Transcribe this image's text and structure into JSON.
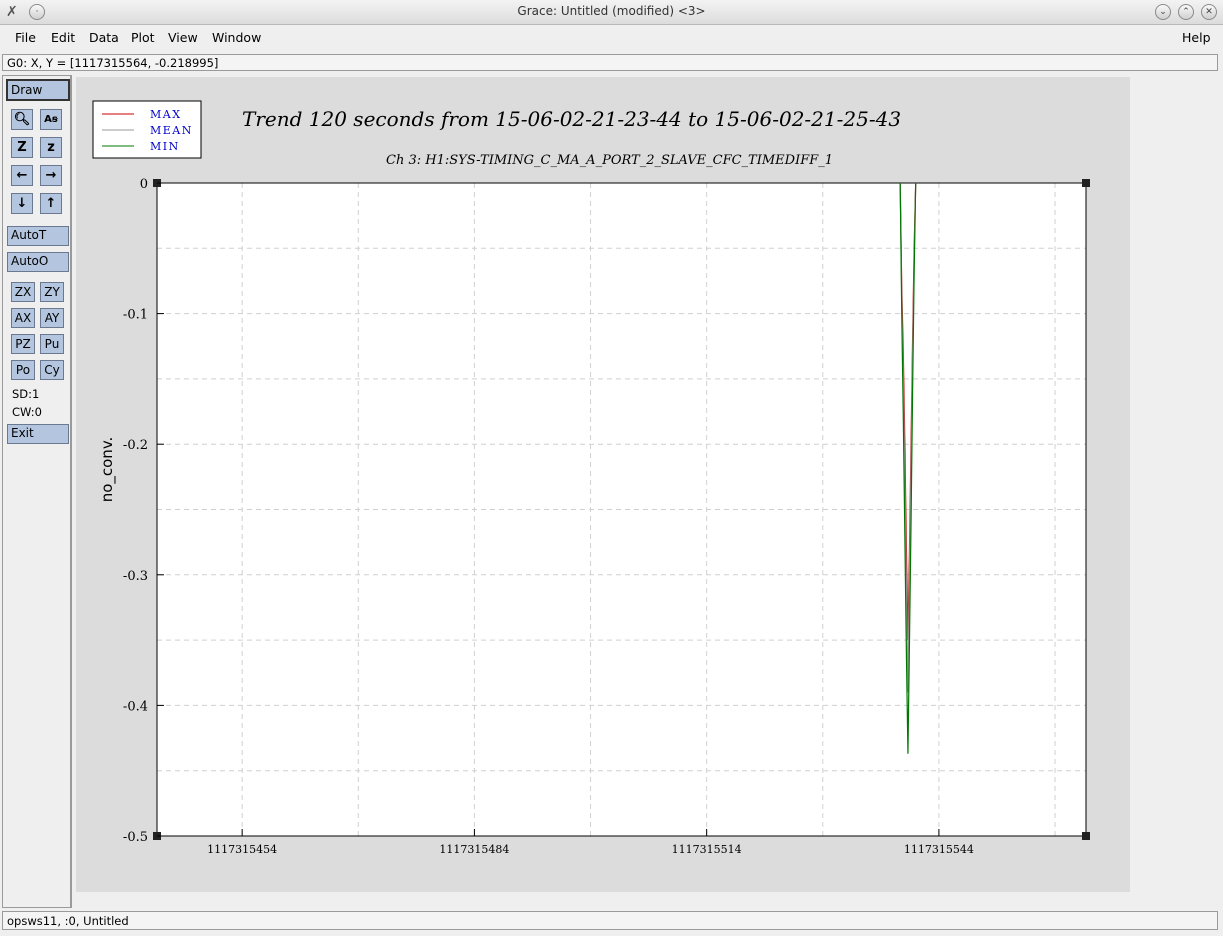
{
  "window": {
    "title": "Grace: Untitled (modified) <3>",
    "controls": [
      "minimize-icon",
      "maximize-icon",
      "close-icon"
    ]
  },
  "menu": {
    "file": "File",
    "edit": "Edit",
    "data": "Data",
    "plot": "Plot",
    "view": "View",
    "window": "Window",
    "help": "Help"
  },
  "locator": "G0: X, Y = [1117315564, -0.218995]",
  "toolbar": {
    "draw": "Draw",
    "icons": [
      "zoom-icon",
      "text-icon",
      "autoscale-z-icon",
      "zoom-z-icon",
      "scroll-left-icon",
      "scroll-right-icon",
      "scroll-down-icon",
      "scroll-up-icon"
    ],
    "autoT": "AutoT",
    "autoO": "AutoO",
    "zx": "ZX",
    "zy": "ZY",
    "ax": "AX",
    "ay": "AY",
    "pz": "PZ",
    "pu": "Pu",
    "po": "Po",
    "cy": "Cy",
    "sd": "SD:1",
    "cw": "CW:0",
    "exit": "Exit"
  },
  "status": "opsws11, :0, Untitled",
  "colors": {
    "max": "#cc0000",
    "mean": "#999999",
    "min": "#007700",
    "legend_text": "#0000cc",
    "button": "#b4c6df"
  },
  "chart_data": {
    "type": "line",
    "title": "Trend 120 seconds from 15-06-02-21-23-44 to 15-06-02-21-25-43",
    "subtitle": "Ch 3: H1:SYS-TIMING_C_MA_A_PORT_2_SLAVE_CFC_TIMEDIFF_1",
    "xlabel": "",
    "ylabel": "no_conv.",
    "xlim": [
      1117315443,
      1117315563
    ],
    "ylim": [
      -0.5,
      0
    ],
    "xticks": [
      1117315454,
      1117315484,
      1117315514,
      1117315544
    ],
    "xtick_labels": [
      "1117315454",
      "1117315484",
      "1117315514",
      "1117315544"
    ],
    "yticks": [
      0,
      -0.1,
      -0.2,
      -0.3,
      -0.4,
      -0.5
    ],
    "ytick_labels": [
      "0",
      "-0.1",
      "-0.2",
      "-0.3",
      "-0.4",
      "-0.5"
    ],
    "grid": true,
    "legend_position": "top-left",
    "series": [
      {
        "name": "MAX",
        "color": "#cc0000",
        "x": [
          1117315539,
          1117315539.2,
          1117315539.4,
          1117315539.6,
          1117315539.8,
          1117315540,
          1117315540.2,
          1117315540.4,
          1117315540.6,
          1117315540.8,
          1117315541
        ],
        "y": [
          0,
          -0.08,
          -0.13,
          -0.2,
          -0.28,
          -0.35,
          -0.28,
          -0.2,
          -0.12,
          -0.05,
          0
        ]
      },
      {
        "name": "MEAN",
        "color": "#999999",
        "x": [
          1117315539,
          1117315539.2,
          1117315539.4,
          1117315539.6,
          1117315539.8,
          1117315540,
          1117315540.2,
          1117315540.4,
          1117315540.6,
          1117315540.8,
          1117315541
        ],
        "y": [
          0,
          -0.09,
          -0.15,
          -0.23,
          -0.31,
          -0.39,
          -0.3,
          -0.22,
          -0.13,
          -0.06,
          0
        ]
      },
      {
        "name": "MIN",
        "color": "#007700",
        "x": [
          1117315539,
          1117315539.2,
          1117315539.4,
          1117315539.6,
          1117315539.8,
          1117315540,
          1117315540.2,
          1117315540.4,
          1117315540.6,
          1117315540.8,
          1117315541
        ],
        "y": [
          0,
          -0.1,
          -0.18,
          -0.27,
          -0.36,
          -0.437,
          -0.35,
          -0.26,
          -0.16,
          -0.07,
          0
        ]
      }
    ]
  }
}
